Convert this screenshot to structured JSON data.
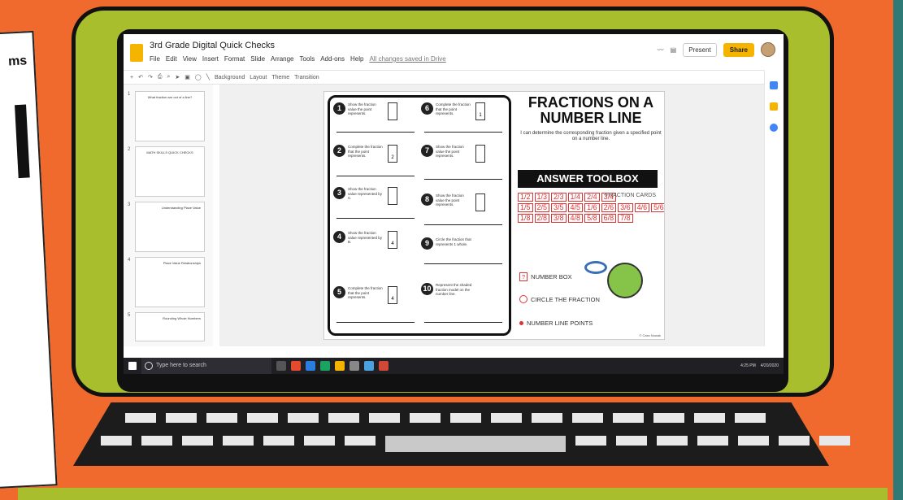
{
  "page_bg": "#ef6a2c",
  "laptop_color": "#a9be2c",
  "slides_app": {
    "title": "3rd Grade Digital Quick Checks",
    "menu": [
      "File",
      "Edit",
      "View",
      "Insert",
      "Format",
      "Slide",
      "Arrange",
      "Tools",
      "Add-ons",
      "Help"
    ],
    "saved_status": "All changes saved in Drive",
    "present_label": "Present",
    "share_label": "Share",
    "toolbar": [
      "Background",
      "Layout",
      "Theme",
      "Transition"
    ],
    "thumbnails": [
      {
        "num": "1",
        "label": "What fraction are out of a line?"
      },
      {
        "num": "2",
        "label": "MATH SKILLS QUICK CHECKS"
      },
      {
        "num": "3",
        "label": "Understanding Place Value"
      },
      {
        "num": "4",
        "label": "Place Value Relationships"
      },
      {
        "num": "5",
        "label": "Rounding Whole Numbers"
      }
    ]
  },
  "slide": {
    "title": "FRACTIONS ON A NUMBER LINE",
    "subtitle": "I can determine the corresponding fraction given a specified point on a number line.",
    "toolbox_title": "ANSWER TOOLBOX",
    "fraction_cards_label": "FRACTION CARDS",
    "fraction_rows": [
      [
        "1/2",
        "1/3",
        "2/3",
        "1/4",
        "2/4",
        "3/4"
      ],
      [
        "1/5",
        "2/5",
        "3/5",
        "4/5",
        "1/6",
        "2/6",
        "3/6",
        "4/6",
        "5/6"
      ],
      [
        "1/8",
        "2/8",
        "3/8",
        "4/8",
        "5/8",
        "6/8",
        "7/8"
      ]
    ],
    "legend": [
      "NUMBER BOX",
      "CIRCLE THE FRACTION",
      "NUMBER LINE POINTS"
    ],
    "credit": "© Cass Nowak",
    "questions": [
      {
        "n": "1",
        "text": "Show the fraction value the point represents."
      },
      {
        "n": "2",
        "text": "Complete the fraction that the point represents.",
        "box": "2"
      },
      {
        "n": "3",
        "text": "Show the fraction value represented by C."
      },
      {
        "n": "4",
        "text": "Show the fraction value represented by B.",
        "box": "4"
      },
      {
        "n": "5",
        "text": "Complete the fraction that the point represents.",
        "box": "4"
      },
      {
        "n": "6",
        "text": "Complete the fraction that the point represents.",
        "box": "1"
      },
      {
        "n": "7",
        "text": "Show the fraction value the point represents."
      },
      {
        "n": "8",
        "text": "Show the fraction value the point represents."
      },
      {
        "n": "9",
        "text": "Circle the fraction that represents 1 whole."
      },
      {
        "n": "10",
        "text": "Represent the shaded fraction model on the number line."
      }
    ]
  },
  "taskbar": {
    "search_placeholder": "Type here to search",
    "time": "4:25 PM",
    "date": "4/20/2020"
  }
}
